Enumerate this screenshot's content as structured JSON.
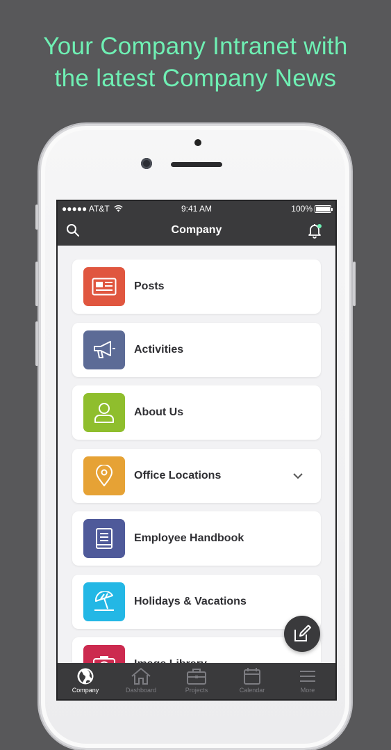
{
  "headline": {
    "line1": "Your Company Intranet with",
    "line2": "the latest Company News"
  },
  "status_bar": {
    "carrier": "●●●●● AT&T",
    "time": "9:41 AM",
    "battery": "100%"
  },
  "nav_bar": {
    "title": "Company",
    "search_icon": "search-icon",
    "notification_icon": "bell-icon"
  },
  "menu": [
    {
      "label": "Posts",
      "icon": "newspaper-icon",
      "color": "#e0563f"
    },
    {
      "label": "Activities",
      "icon": "megaphone-icon",
      "color": "#5c6b96"
    },
    {
      "label": "About Us",
      "icon": "person-icon",
      "color": "#8fbe2d"
    },
    {
      "label": "Office Locations",
      "icon": "location-pin-icon",
      "color": "#e6a235",
      "expandable": true
    },
    {
      "label": "Employee Handbook",
      "icon": "book-icon",
      "color": "#4f5a9a"
    },
    {
      "label": "Holidays & Vacations",
      "icon": "beach-umbrella-icon",
      "color": "#23b7e5"
    },
    {
      "label": "Image Library",
      "icon": "camera-icon",
      "color": "#cc2a4f"
    }
  ],
  "fab": {
    "icon": "edit-icon"
  },
  "tab_bar": [
    {
      "label": "Company",
      "icon": "globe-icon",
      "active": true
    },
    {
      "label": "Dashboard",
      "icon": "home-icon",
      "active": false
    },
    {
      "label": "Projects",
      "icon": "briefcase-icon",
      "active": false
    },
    {
      "label": "Calendar",
      "icon": "calendar-icon",
      "active": false
    },
    {
      "label": "More",
      "icon": "menu-icon",
      "active": false
    }
  ],
  "colors": {
    "headline": "#6ff0b4",
    "background": "#58585a",
    "bar": "#3a3a3c"
  }
}
